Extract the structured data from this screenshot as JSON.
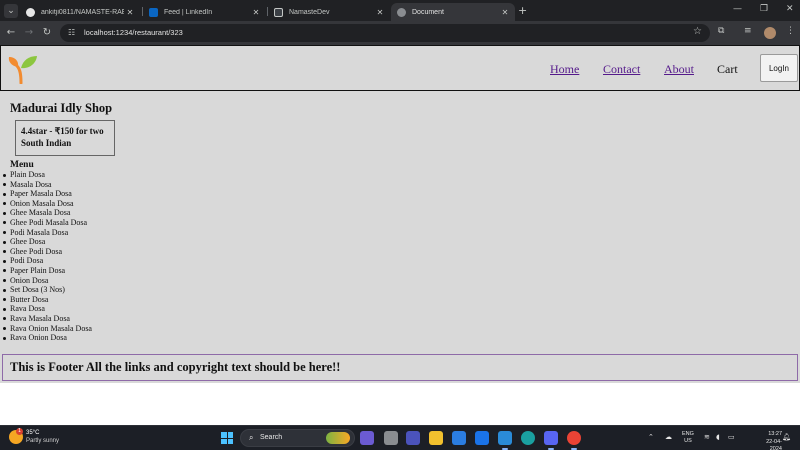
{
  "browser": {
    "tabs": [
      {
        "label": "ankitji0811/NAMASTE-RAECT",
        "icon": "github-icon",
        "active": false
      },
      {
        "label": "Feed | LinkedIn",
        "icon": "linkedin-icon",
        "active": false
      },
      {
        "label": "NamasteDev",
        "icon": "namastedev-icon",
        "active": false
      },
      {
        "label": "Document",
        "icon": "globe-icon",
        "active": true
      }
    ],
    "url": "localhost:1234/restaurant/323"
  },
  "header": {
    "nav": [
      {
        "label": "Home",
        "link": true
      },
      {
        "label": "Contact",
        "link": true
      },
      {
        "label": "About",
        "link": true
      },
      {
        "label": "Cart",
        "link": false
      }
    ],
    "login_label": "LogIn"
  },
  "restaurant": {
    "name": "Madurai Idly Shop",
    "rating_cost": "4.4star - ₹150 for two",
    "cuisine": "South Indian",
    "menu_title": "Menu",
    "menu": [
      "Plain Dosa",
      "Masala Dosa",
      "Paper Masala Dosa",
      "Onion Masala Dosa",
      "Ghee Masala Dosa",
      "Ghee Podi Masala Dosa",
      "Podi Masala Dosa",
      "Ghee Dosa",
      "Ghee Podi Dosa",
      "Podi Dosa",
      "Paper Plain Dosa",
      "Onion Dosa",
      "Set Dosa (3 Nos)",
      "Butter Dosa",
      "Rava Dosa",
      "Rava Masala Dosa",
      "Rava Onion Masala Dosa",
      "Rava Onion Dosa"
    ]
  },
  "footer": {
    "text": "This is Footer All the links and copyright text should be here!!"
  },
  "taskbar": {
    "weather_temp": "35°C",
    "weather_cond": "Partly sunny",
    "weather_badge": "1",
    "search_label": "Search",
    "lang_line1": "ENG",
    "lang_line2": "US",
    "time": "13:27",
    "date": "22-04-2024"
  },
  "colors": {
    "page_bg": "#d9d9d9",
    "link": "#551a8b",
    "footer_border": "#8e6aa8",
    "taskbar": "#1c1f26"
  }
}
